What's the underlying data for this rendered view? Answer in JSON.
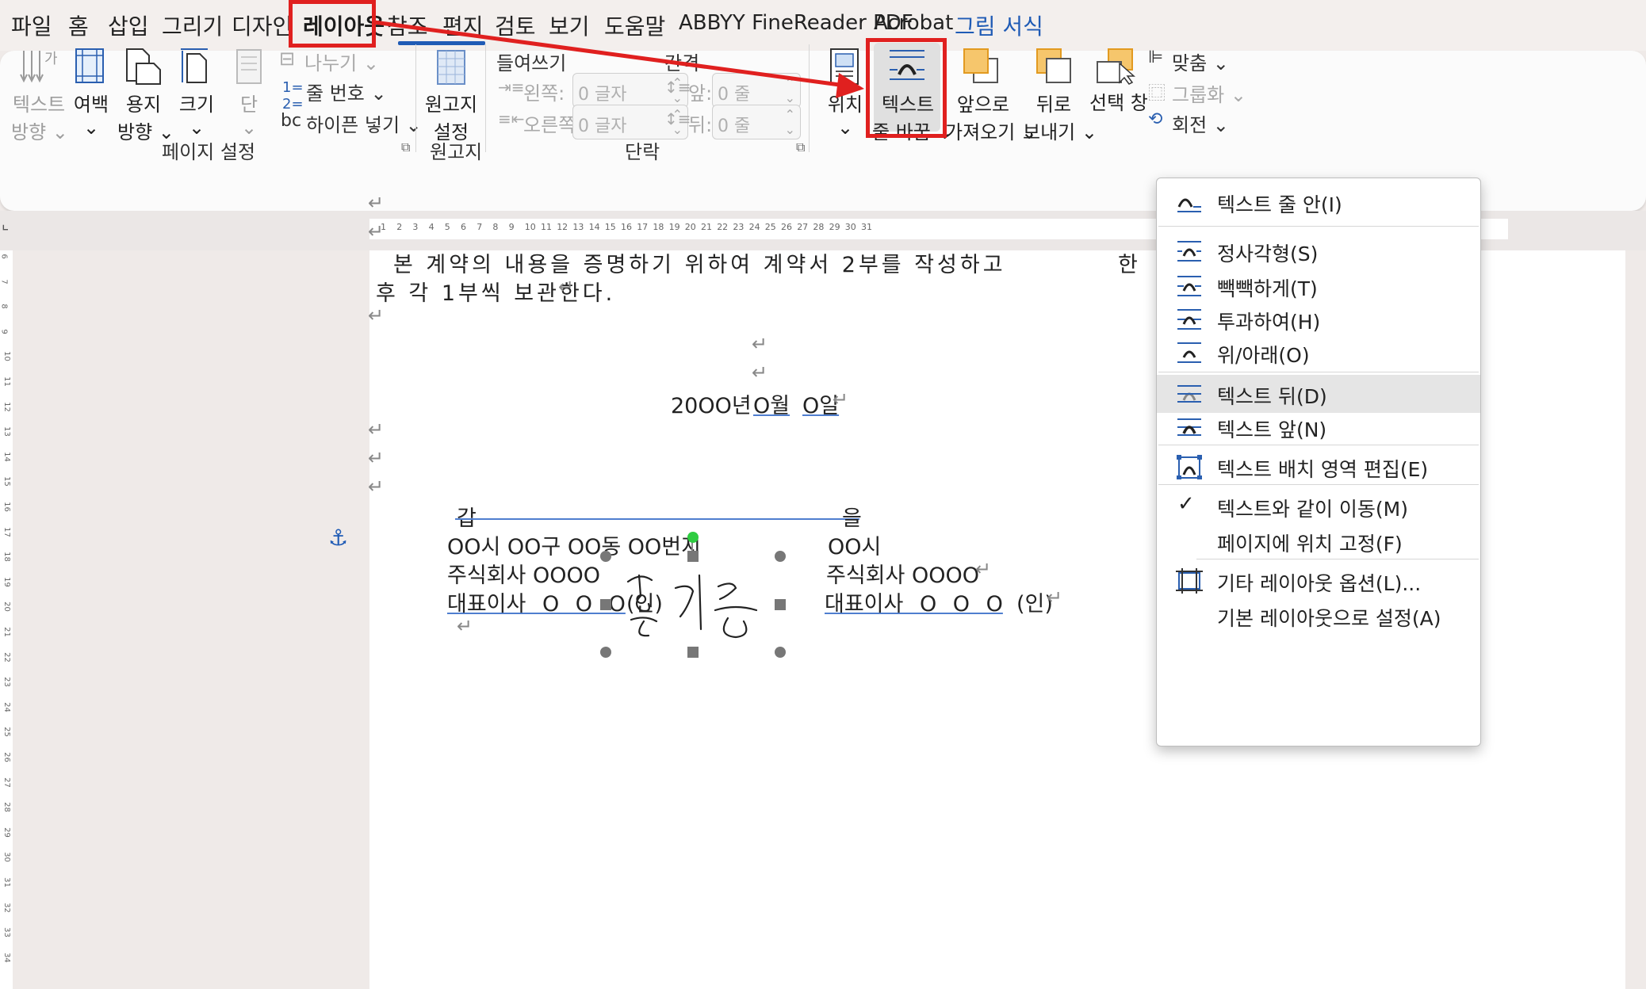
{
  "menu_tabs": [
    "파일",
    "홈",
    "삽입",
    "그리기",
    "디자인",
    "레이아웃",
    "참조",
    "편지",
    "검토",
    "보기",
    "도움말",
    "ABBYY FineReader PDF",
    "Acrobat",
    "그림 서식"
  ],
  "active_tab": "레이아웃",
  "ribbon": {
    "page_setup": {
      "text_direction": [
        "텍스트",
        "방향 ⌄"
      ],
      "margins": [
        "여백",
        "⌄"
      ],
      "orientation": [
        "용지",
        "방향 ⌄"
      ],
      "size": [
        "크기",
        "⌄"
      ],
      "columns": [
        "단",
        "⌄"
      ],
      "breaks": "나누기 ⌄",
      "line_numbers": "줄 번호 ⌄",
      "hyphenation": "하이픈 넣기 ⌄",
      "group_label": "페이지 설정"
    },
    "manuscript": {
      "button": [
        "원고지",
        "설정"
      ],
      "group_label": "원고지"
    },
    "paragraph": {
      "indent_title": "들여쓰기",
      "spacing_title": "간격",
      "left_label": "왼쪽:",
      "right_label": "오른쪽:",
      "before_label": "앞:",
      "after_label": "뒤:",
      "left_value": "0 글자",
      "right_value": "0 글자",
      "before_value": "0 줄",
      "after_value": "0 줄",
      "group_label": "단락"
    },
    "arrange": {
      "position": [
        "위치",
        "⌄"
      ],
      "wrap_text": [
        "텍스트",
        "줄 바꿈 ⌄"
      ],
      "bring_forward": [
        "앞으로",
        "가져오기 ⌄"
      ],
      "send_backward": [
        "뒤로",
        "보내기 ⌄"
      ],
      "selection_pane": "선택 창",
      "align": "맞춤 ⌄",
      "group": "그룹화 ⌄",
      "rotate": "회전 ⌄"
    }
  },
  "ruler_numbers": [
    "1",
    "2",
    "3",
    "4",
    "5",
    "6",
    "7",
    "8",
    "9",
    "10",
    "11",
    "12",
    "13",
    "14",
    "15",
    "16",
    "17",
    "18",
    "19",
    "20",
    "21",
    "22",
    "23",
    "24",
    "25",
    "26",
    "27",
    "28",
    "29",
    "30",
    "31"
  ],
  "vruler_numbers": [
    "6",
    "7",
    "8",
    "9",
    "10",
    "11",
    "12",
    "13",
    "14",
    "15",
    "16",
    "17",
    "18",
    "19",
    "20",
    "21",
    "22",
    "23",
    "24",
    "25",
    "26",
    "27",
    "28",
    "29",
    "30",
    "31",
    "32",
    "33",
    "34"
  ],
  "document": {
    "para1_line1": "본 계약의 내용을 증명하기 위하여 계약서 2부를 작성하고",
    "para1_line1_tail": "한",
    "para1_line2": "후 각 1부씩 보관한다.",
    "date_year": "20OO년",
    "date_month": "O월",
    "date_day": "O일",
    "party_a": "갑",
    "party_b": "을",
    "address_a": "OO시 OO구 OO동 OO번지",
    "address_b": "OO시",
    "company_a": "주식회사 OOOO",
    "company_b": "주식회사 OOOO",
    "rep_a": "대표이사 O O O",
    "seal_a": "(인)",
    "rep_b": "대표이사 O O O",
    "seal_b": "(인)",
    "paragraph_mark": "↵",
    "signature_text": "홍길동"
  },
  "wrap_menu": {
    "items": [
      {
        "label": "텍스트 줄 안(I)"
      },
      {
        "label": "정사각형(S)"
      },
      {
        "label": "빽빽하게(T)"
      },
      {
        "label": "투과하여(H)"
      },
      {
        "label": "위/아래(O)"
      },
      {
        "label": "텍스트 뒤(D)",
        "highlighted": true
      },
      {
        "label": "텍스트 앞(N)"
      },
      {
        "label": "텍스트 배치 영역 편집(E)"
      },
      {
        "label": "텍스트와 같이 이동(M)",
        "checked": true
      },
      {
        "label": "페이지에 위치 고정(F)"
      },
      {
        "label": "기타 레이아웃 옵션(L)..."
      },
      {
        "label": "기본 레이아웃으로 설정(A)"
      }
    ]
  },
  "colors": {
    "accent": "#1f5bb5",
    "annotation": "#e0201f",
    "highlight": "#e5e5e5"
  }
}
